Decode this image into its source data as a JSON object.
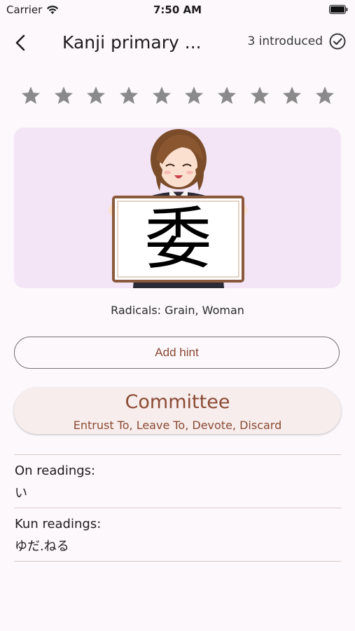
{
  "status_bar": {
    "carrier": "Carrier",
    "time": "7:50 AM"
  },
  "header": {
    "title": "Kanji primary ...",
    "introduced_label": "3 introduced"
  },
  "rating": {
    "star_count": 10,
    "selected": 0
  },
  "kanji": {
    "character": "委"
  },
  "radicals": {
    "text": "Radicals: Grain, Woman"
  },
  "hint_button": {
    "label": "Add hint"
  },
  "meaning": {
    "primary": "Committee",
    "secondary": "Entrust To, Leave To, Devote, Discard"
  },
  "on_readings": {
    "label": "On readings:",
    "value": "い"
  },
  "kun_readings": {
    "label": "Kun readings:",
    "value": "ゆだ.ねる"
  },
  "colors": {
    "accent": "#8b4a34",
    "card_bg": "#f3e5f5",
    "star": "#8a8a8a",
    "background": "#fcf8fc"
  }
}
